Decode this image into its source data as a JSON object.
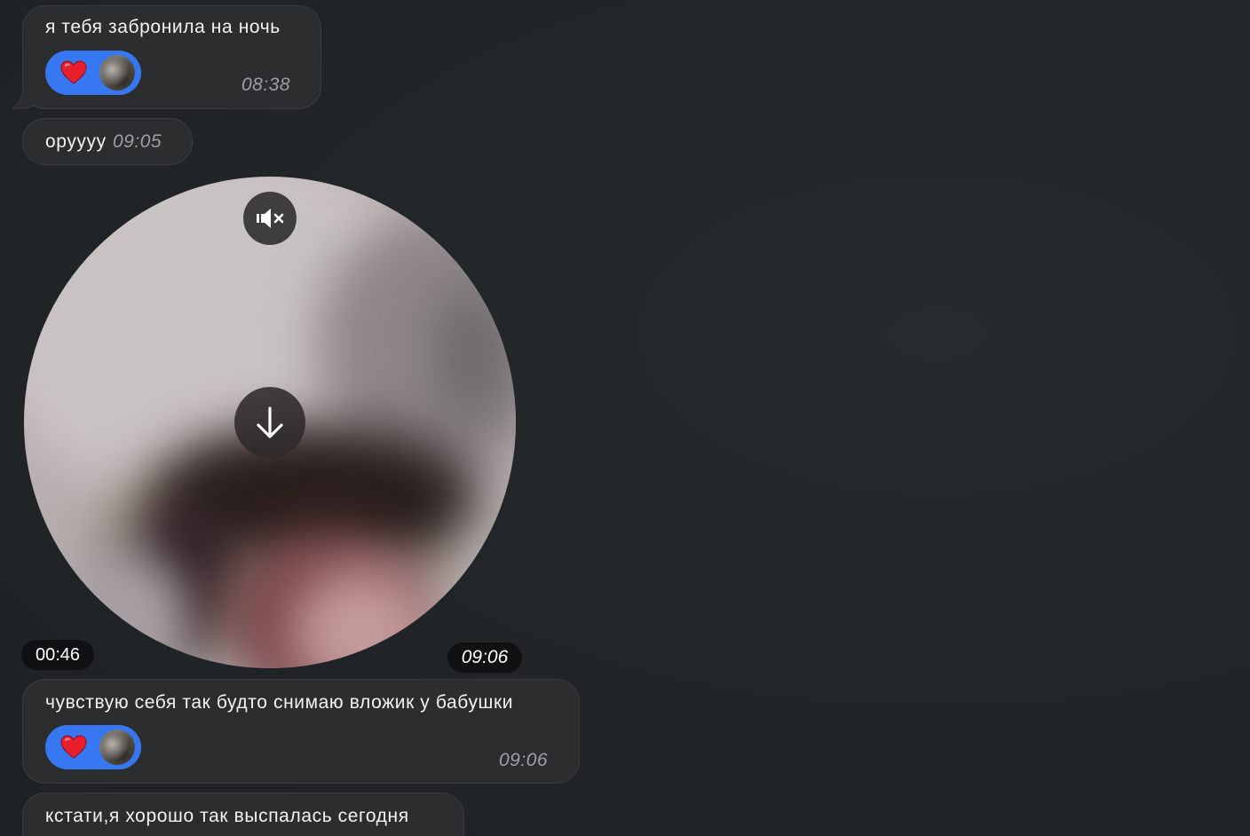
{
  "messages": [
    {
      "text": "я тебя забронила на ночь",
      "time": "08:38",
      "reaction": {
        "emoji_icon": "heart-icon",
        "accent": "#3778f2"
      }
    },
    {
      "text": "оруууу",
      "time": "09:05"
    },
    {
      "video": {
        "duration": "00:46",
        "time": "09:06",
        "mute_icon": "speaker-muted-icon",
        "download_icon": "arrow-down-icon"
      }
    },
    {
      "text": "чувствую себя так будто снимаю вложик у бабушки",
      "time": "09:06",
      "reaction": {
        "emoji_icon": "heart-icon",
        "accent": "#3778f2"
      }
    },
    {
      "text": "кстати,я хорошо так выспалась сегодня"
    }
  ]
}
